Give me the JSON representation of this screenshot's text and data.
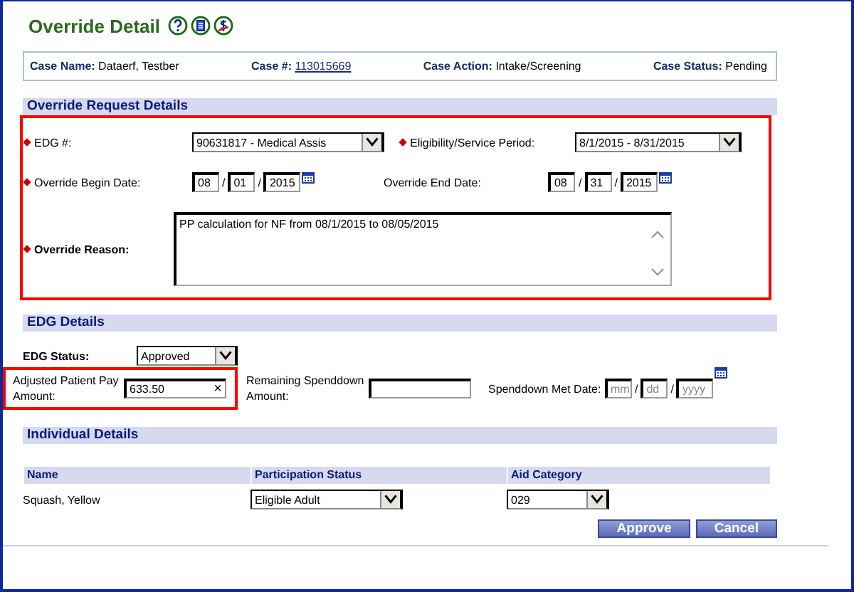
{
  "title": "Override Detail",
  "case": [
    {
      "label": "Case Name:",
      "value": "Dataerf, Testber",
      "link": false
    },
    {
      "label": "Case #:",
      "value": "113015669",
      "link": true
    },
    {
      "label": "Case Action:",
      "value": "Intake/Screening",
      "link": false
    },
    {
      "label": "Case Status:",
      "value": "Pending",
      "link": false
    }
  ],
  "override": {
    "heading": "Override Request Details",
    "highlighted": true,
    "edg": {
      "label": "EDG #:",
      "required": true,
      "value": "90631817 - Medical Assis"
    },
    "period": {
      "label": "Eligibility/Service Period:",
      "required": true,
      "value": "8/1/2015 - 8/31/2015"
    },
    "begin": {
      "label": "Override Begin Date:",
      "required": true,
      "separator": "/",
      "month": "08",
      "day": "01",
      "year": "2015"
    },
    "end": {
      "label": "Override End Date:",
      "required": false,
      "separator": "/",
      "month": "08",
      "day": "31",
      "year": "2015"
    },
    "reason": {
      "label": "Override Reason:",
      "required": true,
      "value": "PP calculation for  NF from 08/1/2015 to  08/05/2015"
    }
  },
  "edg_details": {
    "heading": "EDG Details",
    "status": {
      "label": "EDG Status:",
      "value": "Approved"
    },
    "adjusted": {
      "label": "Adjusted Patient Pay Amount:",
      "value": "633.50",
      "clear": "×",
      "highlighted": true
    },
    "remaining": {
      "label": "Remaining Spenddown Amount:"
    },
    "met_date": {
      "label": "Spenddown Met Date:",
      "separator": "/",
      "month": "mm",
      "day": "dd",
      "year": "yyyy"
    }
  },
  "individual": {
    "heading": "Individual Details",
    "columns": [
      "Name",
      "Participation Status",
      "Aid Category"
    ],
    "rows": [
      {
        "name": "Squash, Yellow",
        "participation": "Eligible Adult",
        "aid": "029"
      }
    ]
  },
  "buttons": [
    "Approve",
    "Cancel"
  ]
}
